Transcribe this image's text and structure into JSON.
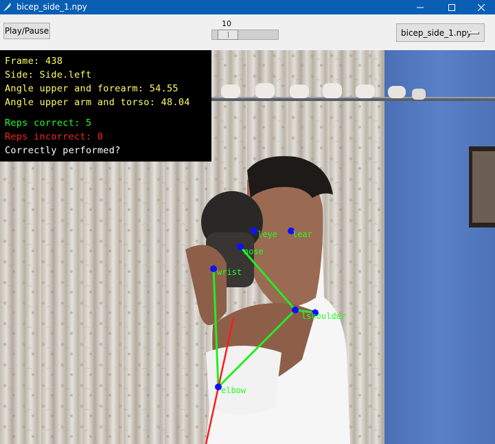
{
  "window": {
    "title": "bicep_side_1.npy",
    "controls": [
      "minimize-icon",
      "maximize-icon",
      "close-icon"
    ]
  },
  "toolbar": {
    "play_pause_label": "Play/Pause",
    "slider_value": "10",
    "file_select_value": "bicep_side_1.npy"
  },
  "overlay": {
    "frame": "Frame: 438",
    "side": "Side: Side.left",
    "angle_forearm": "Angle upper and forearm: 54.55",
    "angle_torso": "Angle upper arm and torso: 48.04",
    "reps_correct": "Reps correct: 5",
    "reps_incorrect": "Reps incorrect: 0",
    "correctly_performed": "Correctly performed?"
  },
  "keypoints": {
    "leye": "leye",
    "lear": "lear",
    "nose": "nose",
    "wrist": "wrist",
    "shoulder": "lshoulder",
    "elbow": "elbow"
  },
  "colors": {
    "titlebar": "#0a5fb4",
    "overlay_text_yellow": "#ffff66",
    "overlay_text_green": "#22ff22",
    "overlay_text_red": "#ff2222",
    "overlay_text_white": "#ffffff",
    "skeleton_green": "#22ee22",
    "skeleton_red": "#ff1a1a",
    "keypoint_blue": "#1010ff"
  }
}
